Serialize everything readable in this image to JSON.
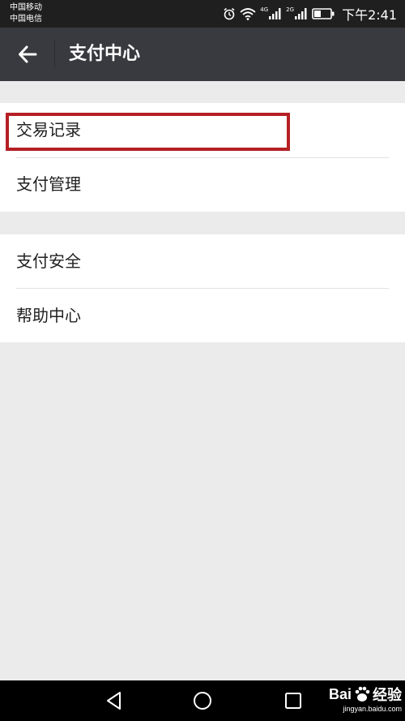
{
  "status_bar": {
    "carrier_1": "中国移动",
    "carrier_2": "中国电信",
    "net_1": "4G",
    "net_2": "2G",
    "time": "下午2:41"
  },
  "header": {
    "title": "支付中心"
  },
  "menu": {
    "group_1": [
      "交易记录",
      "支付管理"
    ],
    "group_2": [
      "支付安全",
      "帮助中心"
    ]
  },
  "watermark": {
    "logo_prefix": "Bai",
    "logo_suffix": "经验",
    "url": "jingyan.baidu.com"
  },
  "colors": {
    "titlebar_bg": "#393a3f",
    "highlight": "#b51f24",
    "page_bg": "#ebebeb"
  }
}
